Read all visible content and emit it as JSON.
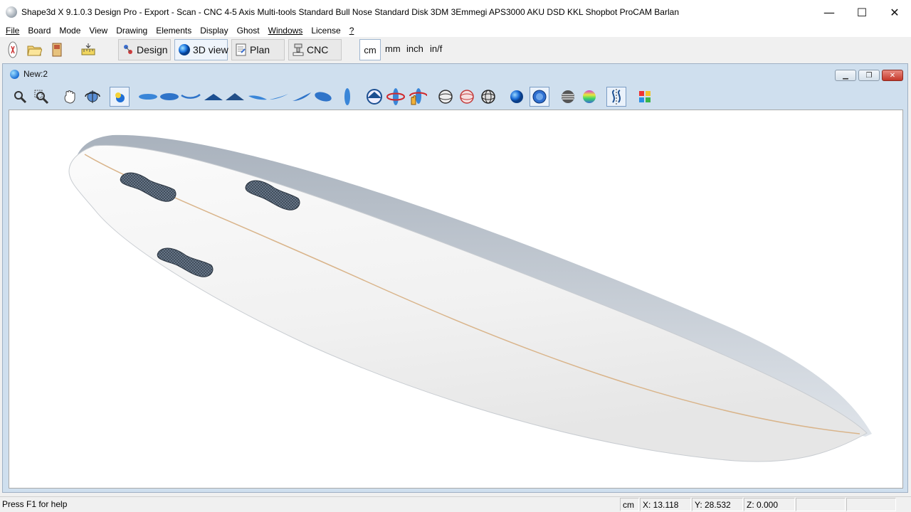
{
  "window": {
    "title": "Shape3d X 9.1.0.3 Design Pro - Export - Scan - CNC 4-5 Axis Multi-tools  Standard Bull Nose Standard Disk 3DM 3Emmegi APS3000 AKU DSD KKL Shopbot ProCAM Barlan",
    "minimize": "—",
    "maximize": "☐",
    "close": "✕"
  },
  "menu": [
    "File",
    "Board",
    "Mode",
    "View",
    "Drawing",
    "Elements",
    "Display",
    "Ghost",
    "Windows",
    "License",
    "?"
  ],
  "toolbar": {
    "icons": [
      "new-file-icon",
      "open-folder-icon",
      "save-board-icon",
      "measure-tool-icon"
    ],
    "modes": {
      "design": "Design",
      "view3d": "3D view",
      "plan": "Plan",
      "cnc": "CNC"
    },
    "active_mode": "3D view",
    "units": [
      "cm",
      "mm",
      "inch",
      "in/f"
    ],
    "selected_unit": "cm"
  },
  "document": {
    "title": "New:2",
    "buttons": {
      "minimize": "▁",
      "restore": "❐",
      "close": "✕"
    }
  },
  "view_toolbar": {
    "icons": [
      "zoom-icon",
      "zoom-window-icon",
      "pan-hand-icon",
      "rotate-view-icon",
      "select-color-icon",
      "bottom-view-icon",
      "top-view-icon",
      "rocker-view-icon",
      "front-view-icon",
      "back-view-icon",
      "side-left-icon",
      "side-right-icon",
      "three-quarter-icon",
      "angle-view-icon",
      "vertical-view-icon",
      "fly-mode-icon",
      "rotate-horizontal-icon",
      "rotate-hand-icon",
      "wire-sphere-icon",
      "red-sphere-icon",
      "mesh-sphere-icon",
      "blue-sphere-icon",
      "shaded-sphere-icon",
      "stripes-sphere-icon",
      "rainbow-sphere-icon",
      "curve-split-icon",
      "color-palette-icon"
    ]
  },
  "status": {
    "help": "Press F1 for help",
    "unit": "cm",
    "x": "X: 13.118",
    "y": "Y: 28.532",
    "z": "Z: 0.000"
  }
}
